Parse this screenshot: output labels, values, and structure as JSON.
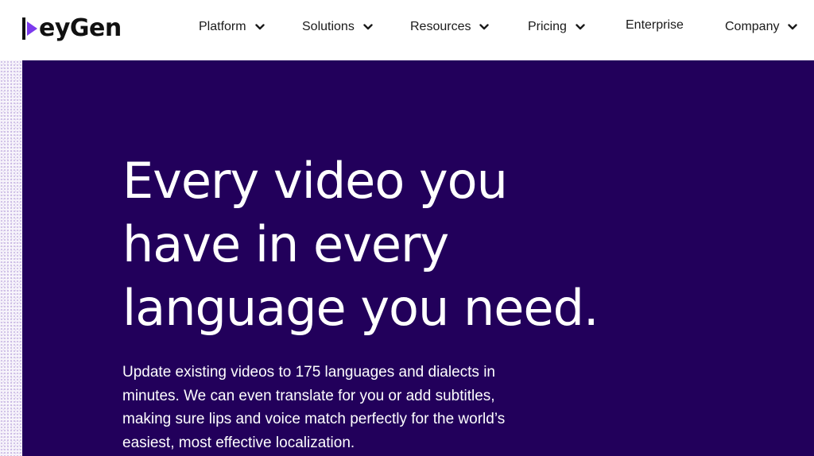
{
  "brand": {
    "name": "HeyGen",
    "logo_text": "eyGen",
    "accent_color": "#7c3aed",
    "hero_background": "#22005b"
  },
  "nav": {
    "items": [
      {
        "label": "Platform",
        "has_dropdown": true,
        "icon": "chevron-down-icon"
      },
      {
        "label": "Solutions",
        "has_dropdown": true,
        "icon": "chevron-down-icon"
      },
      {
        "label": "Resources",
        "has_dropdown": true,
        "icon": "chevron-down-icon"
      },
      {
        "label": "Pricing",
        "has_dropdown": true,
        "icon": "chevron-down-icon"
      },
      {
        "label": "Enterprise",
        "has_dropdown": false
      },
      {
        "label": "Company",
        "has_dropdown": true,
        "icon": "chevron-down-icon"
      }
    ]
  },
  "hero": {
    "heading_lines": [
      "Every video you",
      "have in every",
      "language you need."
    ],
    "body_lines": [
      "Update existing videos to 175 languages and dialects in",
      "minutes. We can even translate for you or add subtitles,",
      "making sure lips and voice match perfectly for the world’s",
      "easiest, most effective localization."
    ]
  }
}
